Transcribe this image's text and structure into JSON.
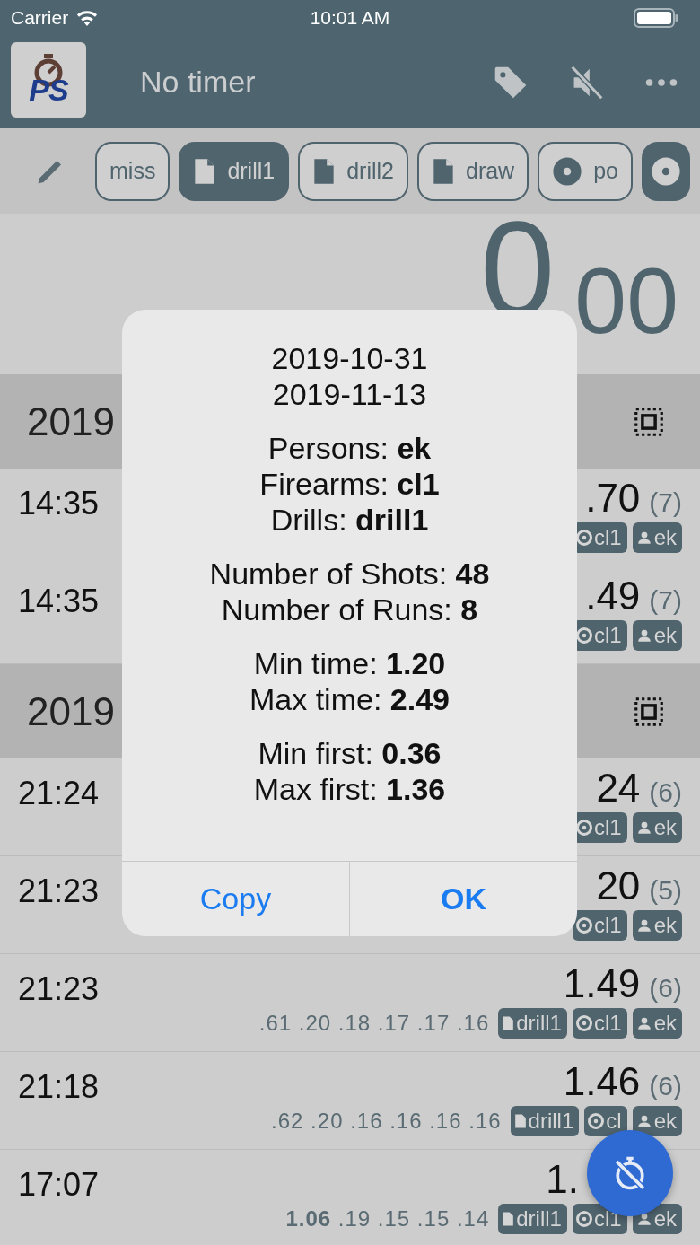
{
  "status_bar": {
    "carrier": "Carrier",
    "time": "10:01 AM"
  },
  "app_bar": {
    "logo_text": "PS",
    "title": "No timer"
  },
  "filter_chips": [
    {
      "kind": "plain",
      "label": "miss",
      "selected": false
    },
    {
      "kind": "doc",
      "label": "drill1",
      "selected": true
    },
    {
      "kind": "doc",
      "label": "drill2",
      "selected": false
    },
    {
      "kind": "doc",
      "label": "draw",
      "selected": false
    },
    {
      "kind": "target",
      "label": "po",
      "selected": false
    },
    {
      "kind": "target",
      "selected": true
    }
  ],
  "timer": {
    "whole": "0",
    "fraction": "00"
  },
  "groups": [
    {
      "header": "2019",
      "rows": [
        {
          "time": "14:35",
          "value": ".70",
          "count": "(7)",
          "tags": [
            {
              "kind": "target",
              "label": "cl1"
            },
            {
              "kind": "person",
              "label": "ek"
            }
          ]
        },
        {
          "time": "14:35",
          "value": ".49",
          "count": "(7)",
          "tags": [
            {
              "kind": "target",
              "label": "cl1"
            },
            {
              "kind": "person",
              "label": "ek"
            }
          ]
        }
      ]
    },
    {
      "header": "2019",
      "rows": [
        {
          "time": "21:24",
          "value": "24",
          "count": "(6)",
          "tags": [
            {
              "kind": "target",
              "label": "cl1"
            },
            {
              "kind": "person",
              "label": "ek"
            }
          ]
        },
        {
          "time": "21:23",
          "value": "20",
          "count": "(5)",
          "tags": [
            {
              "kind": "target",
              "label": "cl1"
            },
            {
              "kind": "person",
              "label": "ek"
            }
          ]
        },
        {
          "time": "21:23",
          "value": "1.49",
          "count": "(6)",
          "splits": ".61 .20 .18 .17 .17 .16",
          "tags": [
            {
              "kind": "doc",
              "label": "drill1"
            },
            {
              "kind": "target",
              "label": "cl1"
            },
            {
              "kind": "person",
              "label": "ek"
            }
          ]
        },
        {
          "time": "21:18",
          "value": "1.46",
          "count": "(6)",
          "splits": ".62 .20 .16 .16 .16 .16",
          "tags": [
            {
              "kind": "doc",
              "label": "drill1"
            },
            {
              "kind": "target",
              "label": "cl"
            },
            {
              "kind": "person",
              "label": "ek"
            }
          ]
        },
        {
          "time": "17:07",
          "value": "1.",
          "splits": "**1.06** .19 .15 .15 .14",
          "tags": [
            {
              "kind": "doc",
              "label": "drill1"
            },
            {
              "kind": "target",
              "label": "cl1"
            },
            {
              "kind": "person",
              "label": "ek"
            }
          ]
        }
      ]
    }
  ],
  "dialog": {
    "sections": [
      [
        "2019-10-31",
        "2019-11-13"
      ],
      [
        "Persons: **ek**",
        "Firearms: **cl1**",
        "Drills: **drill1**"
      ],
      [
        "Number of Shots: **48**",
        "Number of Runs: **8**"
      ],
      [
        "Min time: **1.20**",
        "Max time: **2.49**"
      ],
      [
        "Min first: **0.36**",
        "Max first: **1.36**"
      ]
    ],
    "buttons": [
      {
        "label": "Copy",
        "primary": false
      },
      {
        "label": "OK",
        "primary": true
      }
    ]
  }
}
